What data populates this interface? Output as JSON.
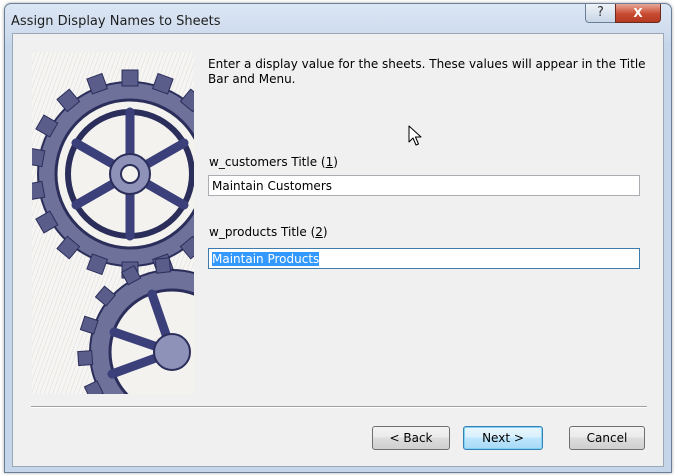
{
  "window": {
    "title": "Assign Display Names to Sheets",
    "help_label": "?",
    "close_label": "X"
  },
  "instructions": "Enter a display value for the sheets.  These values will appear in the Title Bar and Menu.",
  "fields": [
    {
      "label_prefix": "w_customers Title (",
      "accesskey": "1",
      "label_suffix": ")",
      "value": "Maintain Customers"
    },
    {
      "label_prefix": "w_products Title (",
      "accesskey": "2",
      "label_suffix": ")",
      "value": "Maintain Products"
    }
  ],
  "buttons": {
    "back": "< Back",
    "next": "Next >",
    "cancel": "Cancel"
  },
  "colors": {
    "selection": "#3399ff",
    "close_button": "#c84a30",
    "gear_ink": "#3b3f7a"
  }
}
